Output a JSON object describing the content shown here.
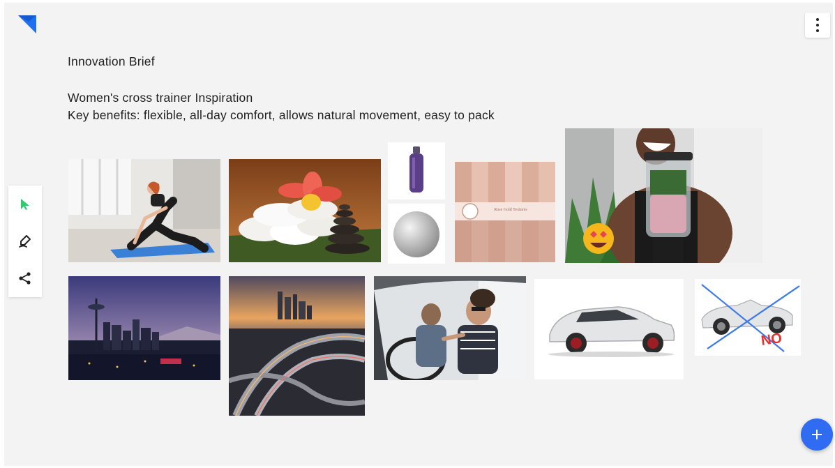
{
  "brief": {
    "heading": "Innovation Brief",
    "line1": "Women's cross trainer Inspiration",
    "line2": "Key benefits: flexible, all-day comfort, allows natural movement, easy to pack"
  },
  "toolbar": {
    "tools": [
      "cursor-icon",
      "pen-icon",
      "share-icon"
    ],
    "active_color": "#2ecc71"
  },
  "menu": {
    "icon": "more-vertical-icon"
  },
  "fab": {
    "label": "+",
    "color": "#2f6cf2"
  },
  "logo": {
    "color": "#1e6ff2"
  },
  "tiles": {
    "rose_gold_title": "Rose Gold Textures",
    "no_sign": "NO"
  }
}
